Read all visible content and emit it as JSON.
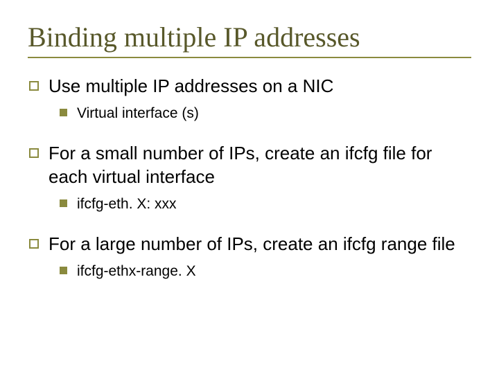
{
  "title": "Binding multiple IP addresses",
  "bullets": [
    {
      "text": "Use multiple IP addresses on a NIC",
      "sub": [
        {
          "text": "Virtual interface (s)"
        }
      ]
    },
    {
      "text": "For a small number of IPs, create an ifcfg file for each virtual interface",
      "sub": [
        {
          "text": "ifcfg-eth. X: xxx"
        }
      ]
    },
    {
      "text": "For a large number of IPs, create an ifcfg range file",
      "sub": [
        {
          "text": "ifcfg-ethx-range. X"
        }
      ]
    }
  ]
}
